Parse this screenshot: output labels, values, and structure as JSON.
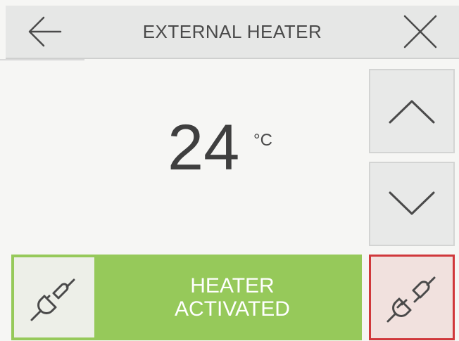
{
  "header": {
    "title": "EXTERNAL HEATER",
    "back_icon": "arrow-left-icon",
    "close_icon": "close-icon"
  },
  "temperature": {
    "value": "24",
    "unit": "°C"
  },
  "controls": {
    "up_icon": "chevron-up-icon",
    "down_icon": "chevron-down-icon"
  },
  "status": {
    "line1": "HEATER",
    "line2": "ACTIVATED",
    "icon": "plug-connected-icon",
    "color": "#96c95a"
  },
  "disconnect": {
    "icon": "plug-disconnected-icon",
    "border_color": "#d0383b",
    "background_color": "#f1e1de"
  }
}
